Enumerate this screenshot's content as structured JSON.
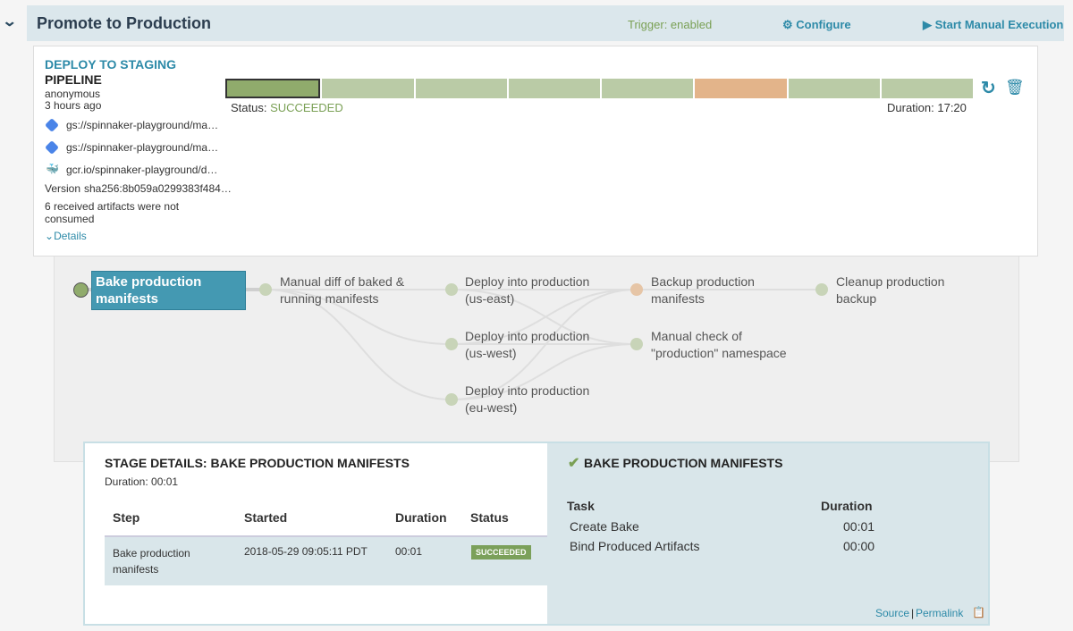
{
  "header": {
    "title": "Promote to Production",
    "trigger": "Trigger: enabled",
    "configure": "Configure",
    "start": "Start Manual Execution"
  },
  "execution": {
    "name": "DEPLOY TO STAGING",
    "type": "PIPELINE",
    "user": "anonymous",
    "time": "3 hours ago",
    "artifacts": [
      "gs://spinnaker-playground/ma…",
      "gs://spinnaker-playground/ma…",
      "gcr.io/spinnaker-playground/d…"
    ],
    "version_label": "Version",
    "version": "sha256:8b059a0299383f484…",
    "unconsumed": "6 received artifacts were not consumed",
    "details": "Details",
    "status_label": "Status:",
    "status": "SUCCEEDED",
    "duration": "Duration: 17:20",
    "stage_statuses": [
      "succeeded-active",
      "succeeded",
      "succeeded",
      "succeeded",
      "succeeded",
      "warning",
      "succeeded",
      "succeeded"
    ]
  },
  "graph": {
    "nodes": [
      {
        "label": "Bake production manifests"
      },
      {
        "label": "Manual diff of baked & running manifests"
      },
      {
        "label": "Deploy into production (us-east)"
      },
      {
        "label": "Deploy into production (us-west)"
      },
      {
        "label": "Deploy into production (eu-west)"
      },
      {
        "label": "Backup production manifests"
      },
      {
        "label": "Manual check of \"production\" namespace"
      },
      {
        "label": "Cleanup production backup"
      }
    ]
  },
  "stage": {
    "title": "STAGE DETAILS: BAKE PRODUCTION MANIFESTS",
    "duration": "Duration: 00:01",
    "columns": [
      "Step",
      "Started",
      "Duration",
      "Status"
    ],
    "rows": [
      {
        "step": "Bake production manifests",
        "started": "2018-05-29 09:05:11 PDT",
        "duration": "00:01",
        "status": "SUCCEEDED"
      }
    ]
  },
  "tasks": {
    "title": "BAKE PRODUCTION MANIFESTS",
    "columns": [
      "Task",
      "Duration"
    ],
    "rows": [
      {
        "task": "Create Bake",
        "duration": "00:01"
      },
      {
        "task": "Bind Produced Artifacts",
        "duration": "00:00"
      }
    ],
    "source": "Source",
    "permalink": "Permalink"
  }
}
